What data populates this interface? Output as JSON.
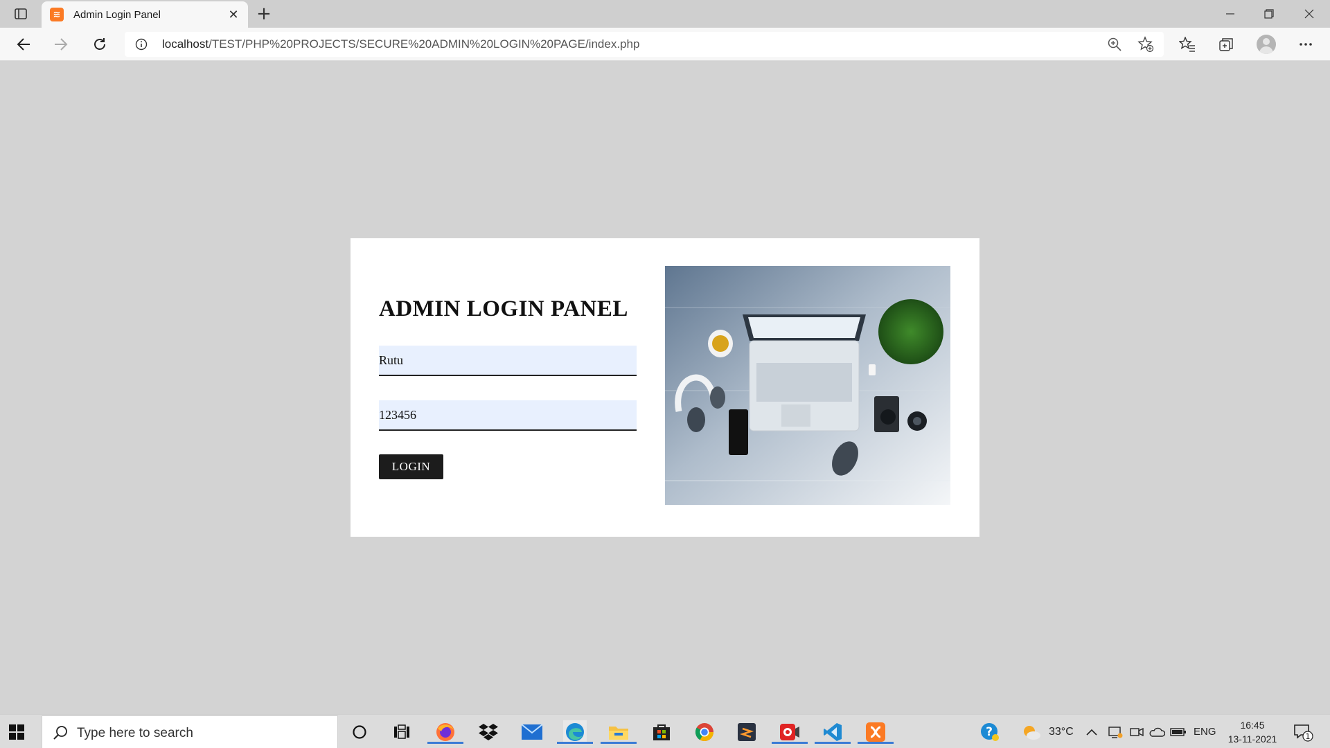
{
  "browser": {
    "tab_title": "Admin Login Panel",
    "favicon_label": "≋",
    "url_host": "localhost",
    "url_path": "/TEST/PHP%20PROJECTS/SECURE%20ADMIN%20LOGIN%20PAGE/index.php"
  },
  "login": {
    "title": "ADMIN LOGIN PANEL",
    "username_value": "Rutu",
    "password_value": "123456",
    "button_label": "LOGIN"
  },
  "taskbar": {
    "search_placeholder": "Type here to search",
    "weather_temp": "33°C",
    "language": "ENG",
    "time": "16:45",
    "date": "13-11-2021",
    "notification_count": "1",
    "apps": [
      "firefox-icon",
      "dropbox-icon",
      "mail-icon",
      "edge-icon",
      "file-explorer-icon",
      "store-icon",
      "chrome-icon",
      "sublime-text-icon",
      "screen-recorder-icon",
      "vscode-icon",
      "xampp-icon"
    ]
  },
  "colors": {
    "page_background": "#d3d3d3",
    "input_background": "#e8f0fe",
    "button_background": "#1c1c1c",
    "xampp_orange": "#fb7a24"
  }
}
